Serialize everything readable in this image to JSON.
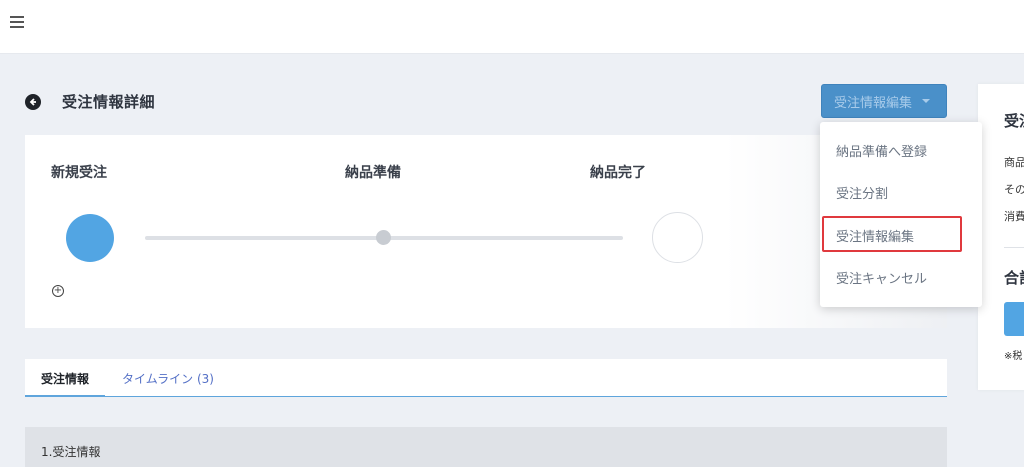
{
  "header": {
    "menu_icon": "hamburger-icon"
  },
  "page": {
    "title": "受注情報詳細",
    "back_icon": "back-arrow-circle-icon",
    "edit_button_label": "受注情報編集"
  },
  "status": {
    "steps": [
      {
        "label": "新規受注",
        "state": "active"
      },
      {
        "label": "納品準備",
        "state": "pending"
      },
      {
        "label": "納品完了",
        "state": "pending"
      }
    ],
    "add_icon": "plus-circle-icon",
    "colors": {
      "active": "#52a5e3",
      "track": "#dde0e5"
    }
  },
  "dropdown": {
    "items": [
      {
        "label": "納品準備へ登録"
      },
      {
        "label": "受注分割"
      },
      {
        "label": "受注情報編集",
        "highlighted": true
      },
      {
        "label": "受注キャンセル"
      }
    ]
  },
  "tabs": [
    {
      "label": "受注情報",
      "active": true
    },
    {
      "label": "タイムライン (3)",
      "active": false
    }
  ],
  "section": {
    "title": "1.受注情報"
  },
  "right_panel": {
    "title": "受注",
    "lines": [
      "商品",
      "その",
      "消費"
    ],
    "total_label": "合計",
    "note": "※税"
  },
  "colors": {
    "primary": "#4a90c9",
    "highlight_border": "#e0393e",
    "tab_link": "#5470c6"
  }
}
